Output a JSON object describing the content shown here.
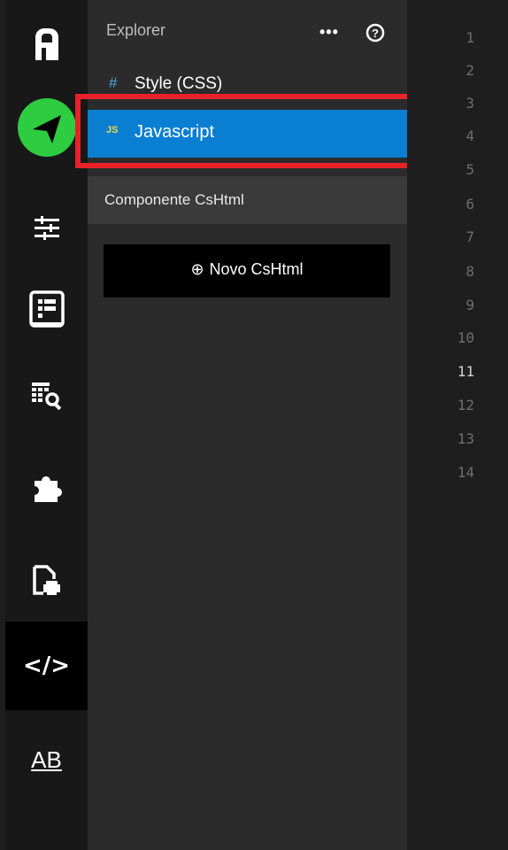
{
  "activity_bar": {
    "items": [
      {
        "name": "app-logo-icon"
      },
      {
        "name": "send-icon"
      },
      {
        "name": "sliders-icon"
      },
      {
        "name": "layout-icon"
      },
      {
        "name": "table-search-icon"
      },
      {
        "name": "puzzle-icon"
      },
      {
        "name": "print-file-icon"
      },
      {
        "name": "code-icon",
        "symbol": "</>"
      },
      {
        "name": "text-style-icon",
        "symbol": "AB"
      }
    ],
    "active": "code-icon"
  },
  "explorer": {
    "title": "Explorer",
    "more_label": "•••",
    "help_label": "?",
    "files": [
      {
        "icon": "#",
        "label": "Style (CSS)"
      },
      {
        "icon": "JS",
        "label": "Javascript",
        "selected": true
      }
    ],
    "section_header": "Componente CsHtml",
    "new_button": {
      "icon": "⊕",
      "label": "Novo CsHtml"
    }
  },
  "editor": {
    "line_numbers": [
      "1",
      "2",
      "3",
      "4",
      "5",
      "6",
      "7",
      "8",
      "9",
      "10",
      "11",
      "12",
      "13",
      "14"
    ],
    "current_line": "11"
  },
  "colors": {
    "selected_item": "#0a7fd1",
    "highlight_box": "#e8222b",
    "send_button": "#2ecc40",
    "activity_bar": "#181818",
    "panel": "#2b2b2b"
  }
}
